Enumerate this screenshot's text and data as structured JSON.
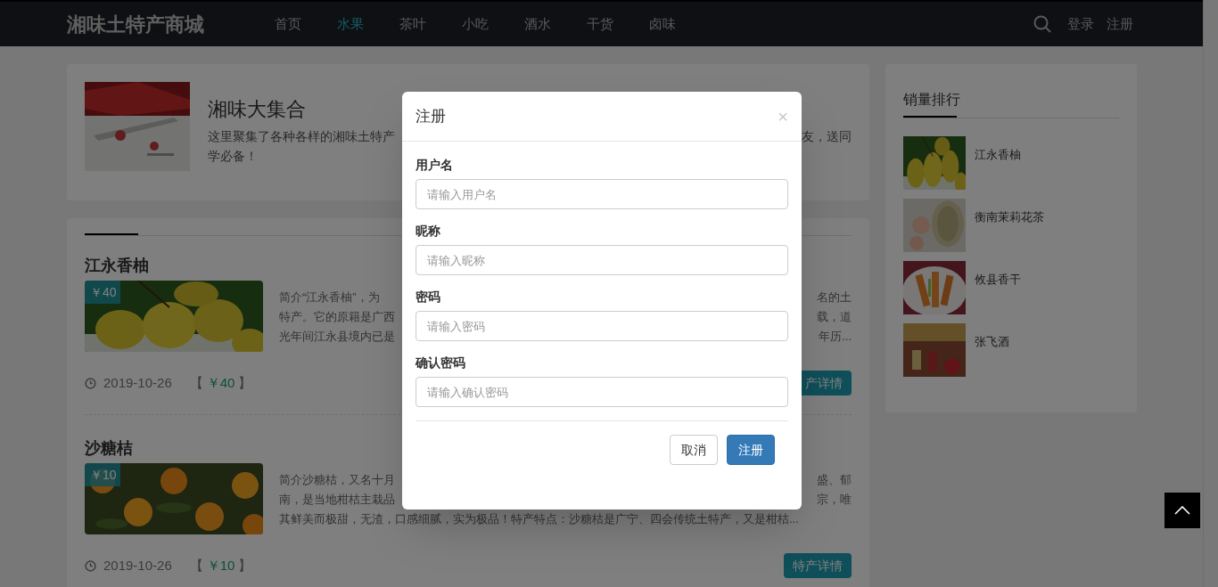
{
  "navbar": {
    "brand": "湘味土特产商城",
    "links": [
      {
        "label": "首页",
        "selected": false
      },
      {
        "label": "水果",
        "selected": true
      },
      {
        "label": "茶叶",
        "selected": false
      },
      {
        "label": "小吃",
        "selected": false
      },
      {
        "label": "酒水",
        "selected": false
      },
      {
        "label": "干货",
        "selected": false
      },
      {
        "label": "卤味",
        "selected": false
      }
    ],
    "auth_links": [
      "登录",
      "注册"
    ]
  },
  "intro": {
    "title": "湘味大集合",
    "lines": [
      {
        "left": "这里聚集了各种各样的湘味土特产",
        "right": "友，送同"
      },
      {
        "left": "学必备！"
      }
    ]
  },
  "products": [
    {
      "name": "江永香柚",
      "badge": "￥40",
      "lines": [
        {
          "left": "简介“江永香柚”，为",
          "right": "名的土"
        },
        {
          "left": "特产。它的原籍是广西",
          "right": "载，道"
        },
        {
          "left": "光年间江永县境内已是",
          "right": "年历..."
        }
      ],
      "date": "2019-10-26",
      "bracket_open": "【",
      "price": "￥40",
      "bracket_close": "】",
      "detail_button": "产详情"
    },
    {
      "name": "沙糖桔",
      "badge": "￥10",
      "lines": [
        {
          "left": "简介沙糖桔，又名十月",
          "right": "盛、郁"
        },
        {
          "left": "南，是当地柑桔主栽品",
          "right": "宗，唯"
        },
        {
          "left": "其鲜美而极甜，无渣，口感细腻，实为极品！特产特点：沙糖桔是广宁、四会传统土特产，又是柑桔..."
        }
      ],
      "date": "2019-10-26",
      "bracket_open": "【",
      "price": "￥10",
      "bracket_close": "】",
      "detail_button": "特产详情"
    }
  ],
  "ranking": {
    "title": "销量排行",
    "items": [
      {
        "name": "江永香柚"
      },
      {
        "name": "衡南茉莉花茶"
      },
      {
        "name": "攸县香干"
      },
      {
        "name": "张飞酒"
      }
    ]
  },
  "modal": {
    "title": "注册",
    "close": "×",
    "fields": [
      {
        "label": "用户名",
        "placeholder": "请输入用户名"
      },
      {
        "label": "昵称",
        "placeholder": "请输入昵称"
      },
      {
        "label": "密码",
        "placeholder": "请输入密码"
      },
      {
        "label": "确认密码",
        "placeholder": "请输入确认密码"
      }
    ],
    "buttons": [
      {
        "label": "取消",
        "kind": "default"
      },
      {
        "label": "注册",
        "kind": "primary"
      }
    ]
  }
}
